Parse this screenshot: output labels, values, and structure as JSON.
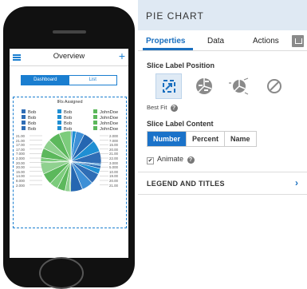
{
  "device": {
    "header_title": "Overview",
    "plus_glyph": "+",
    "segments": [
      {
        "label": "Dashboard",
        "selected": true
      },
      {
        "label": "List",
        "selected": false
      }
    ],
    "chart_data": {
      "type": "pie",
      "title": "IRs Assigned",
      "legend": [
        [
          "Bob",
          "Bob",
          "JohnDoe"
        ],
        [
          "Bob",
          "Bob",
          "JohnDoe"
        ],
        [
          "Bob",
          "Bob",
          "JohnDoe"
        ],
        [
          "Bob",
          "Bob",
          "JohnDoe"
        ]
      ],
      "legend_colors": [
        "#2f6db5",
        "#1f8fd3",
        "#5cb85c"
      ],
      "left_labels": [
        "21.00",
        "21.00",
        "17.00",
        "17.00",
        "7.000",
        "2.000",
        "20.00",
        "20.00",
        "15.00",
        "14.00",
        "8.000",
        "2.000"
      ],
      "right_labels": [
        "2.000",
        "7.000",
        "15.00",
        "20.00",
        "21.00",
        "22.00",
        "3.000",
        "5.000",
        "10.00",
        "19.00",
        "20.00",
        "21.00"
      ],
      "values": [
        2,
        7,
        15,
        20,
        21,
        22,
        3,
        5,
        10,
        19,
        20,
        21,
        2,
        8,
        14,
        15,
        20,
        20,
        2,
        7,
        17,
        17,
        21,
        21
      ],
      "slice_colors": [
        "#2f6db5",
        "#1f8fd3",
        "#3d8fd6",
        "#2567b1",
        "#1f8fd3",
        "#2f6db5",
        "#4aa1de",
        "#2567b1",
        "#1f8fd3",
        "#2f6db5",
        "#3d8fd6",
        "#2567b1",
        "#5cb85c",
        "#8fd18f",
        "#5cb85c",
        "#7ccc7c",
        "#5cb85c",
        "#8fd18f",
        "#5cb85c",
        "#7ccc7c",
        "#5cb85c",
        "#8fd18f",
        "#5cb85c",
        "#7ccc7c"
      ]
    }
  },
  "panel": {
    "title": "PIE CHART",
    "tabs": [
      {
        "label": "Properties",
        "selected": true
      },
      {
        "label": "Data",
        "selected": false
      },
      {
        "label": "Actions",
        "selected": false
      }
    ],
    "slice_label_position": {
      "heading": "Slice Label Position",
      "options": [
        "best-fit-icon",
        "inside-labels-icon",
        "outside-labels-icon",
        "none-icon"
      ],
      "selected_caption": "Best Fit",
      "help": "?"
    },
    "slice_label_content": {
      "heading": "Slice Label Content",
      "buttons": [
        {
          "label": "Number",
          "selected": true
        },
        {
          "label": "Percent",
          "selected": false
        },
        {
          "label": "Name",
          "selected": false
        }
      ]
    },
    "animate": {
      "label": "Animate",
      "checked": true,
      "check_glyph": "✔",
      "help": "?"
    },
    "legend_section": {
      "label": "LEGEND AND TITLES",
      "chevron": "›"
    },
    "accent": "#1a72c9"
  }
}
